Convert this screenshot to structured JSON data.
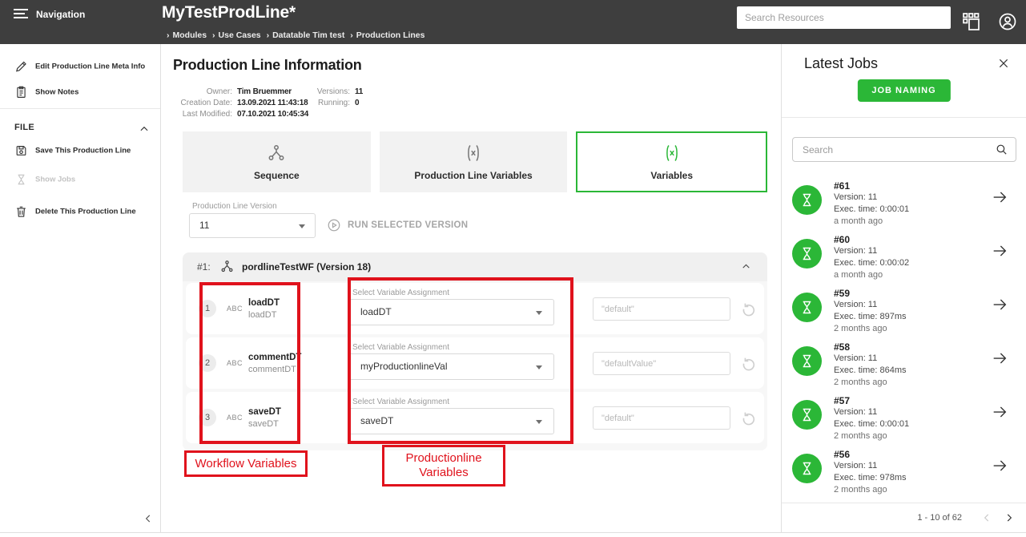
{
  "colors": {
    "accent_green": "#2bb737",
    "annotation_red": "#e0121c",
    "header_bg": "#3e3e3e"
  },
  "header": {
    "nav_label": "Navigation",
    "title": "MyTestProdLine*",
    "breadcrumb": [
      "Modules",
      "Use Cases",
      "Datatable Tim test",
      "Production Lines"
    ],
    "search_placeholder": "Search Resources"
  },
  "sidebar": {
    "edit_meta_label": "Edit Production Line Meta Info",
    "show_notes_label": "Show Notes",
    "file_section_title": "FILE",
    "save_label": "Save This Production Line",
    "show_jobs_label": "Show Jobs",
    "delete_label": "Delete This Production Line"
  },
  "main": {
    "title": "Production Line Information",
    "meta": {
      "owner_label": "Owner:",
      "owner": "Tim Bruemmer",
      "creation_label": "Creation Date:",
      "creation": "13.09.2021 11:43:18",
      "modified_label": "Last Modified:",
      "modified": "07.10.2021 10:45:34",
      "versions_label": "Versions:",
      "versions": "11",
      "running_label": "Running:",
      "running": "0"
    },
    "tabs": [
      {
        "label": "Sequence"
      },
      {
        "label": "Production Line Variables"
      },
      {
        "label": "Variables"
      }
    ],
    "version_select": {
      "label": "Production Line Version",
      "value": "11"
    },
    "run_button_label": "RUN SELECTED VERSION",
    "panel": {
      "index": "#1:",
      "title": "pordlineTestWF (Version 18)",
      "rows": [
        {
          "num": "1",
          "type": "ABC",
          "name": "loadDT",
          "subname": "loadDT",
          "select_label": "Select Variable Assignment",
          "select_value": "loadDT",
          "placeholder": "\"default\""
        },
        {
          "num": "2",
          "type": "ABC",
          "name": "commentDT",
          "subname": "commentDT",
          "select_label": "Select Variable Assignment",
          "select_value": "myProductionlineVal",
          "placeholder": "\"defaultValue\""
        },
        {
          "num": "3",
          "type": "ABC",
          "name": "saveDT",
          "subname": "saveDT",
          "select_label": "Select Variable Assignment",
          "select_value": "saveDT",
          "placeholder": "\"default\""
        }
      ]
    },
    "annotations": {
      "workflow_label": "Workflow Variables",
      "productionline_label_line1": "Productionline",
      "productionline_label_line2": "Variables"
    }
  },
  "jobs_panel": {
    "title": "Latest Jobs",
    "job_naming_button": "JOB NAMING",
    "search_placeholder": "Search",
    "items": [
      {
        "id": "#61",
        "version": "Version: 11",
        "exec": "Exec. time: 0:00:01",
        "ago": "a month ago"
      },
      {
        "id": "#60",
        "version": "Version: 11",
        "exec": "Exec. time: 0:00:02",
        "ago": "a month ago"
      },
      {
        "id": "#59",
        "version": "Version: 11",
        "exec": "Exec. time: 897ms",
        "ago": "2 months ago"
      },
      {
        "id": "#58",
        "version": "Version: 11",
        "exec": "Exec. time: 864ms",
        "ago": "2 months ago"
      },
      {
        "id": "#57",
        "version": "Version: 11",
        "exec": "Exec. time: 0:00:01",
        "ago": "2 months ago"
      },
      {
        "id": "#56",
        "version": "Version: 11",
        "exec": "Exec. time: 978ms",
        "ago": "2 months ago"
      }
    ],
    "pagination": "1 - 10 of 62"
  }
}
